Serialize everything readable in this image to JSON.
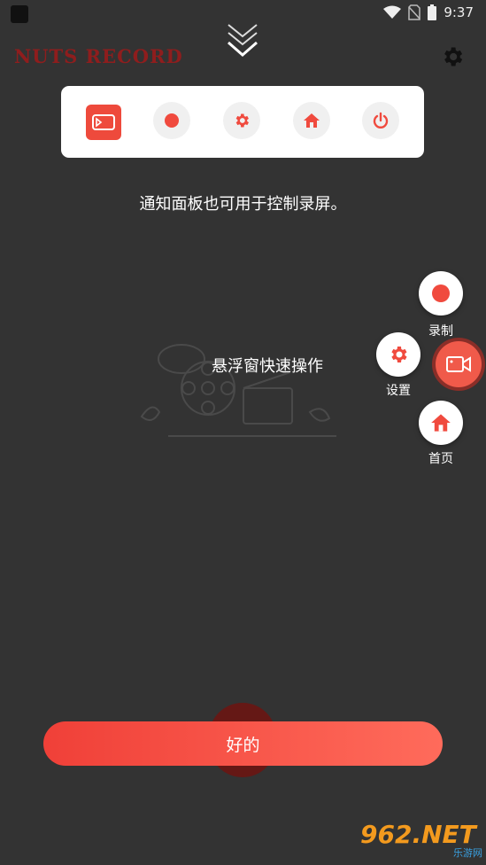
{
  "status_bar": {
    "time": "9:37"
  },
  "header": {
    "logo_text": "NUTS RECORD"
  },
  "panel": {
    "buttons": [
      {
        "name": "app",
        "icon": "video-camera-icon"
      },
      {
        "name": "record",
        "icon": "record-dot-icon"
      },
      {
        "name": "settings",
        "icon": "gear-icon"
      },
      {
        "name": "home",
        "icon": "home-icon"
      },
      {
        "name": "power",
        "icon": "power-icon"
      }
    ]
  },
  "hints": {
    "notification": "通知面板也可用于控制录屏。",
    "floating": "悬浮窗快速操作"
  },
  "floating_menu": {
    "record_label": "录制",
    "settings_label": "设置",
    "home_label": "首页"
  },
  "ok_button": {
    "label": "好的"
  },
  "watermark": {
    "main": "962.NET",
    "sub": "乐游网"
  },
  "colors": {
    "accent": "#f04a3e",
    "background": "#333333",
    "logo": "#8f1d1d"
  }
}
